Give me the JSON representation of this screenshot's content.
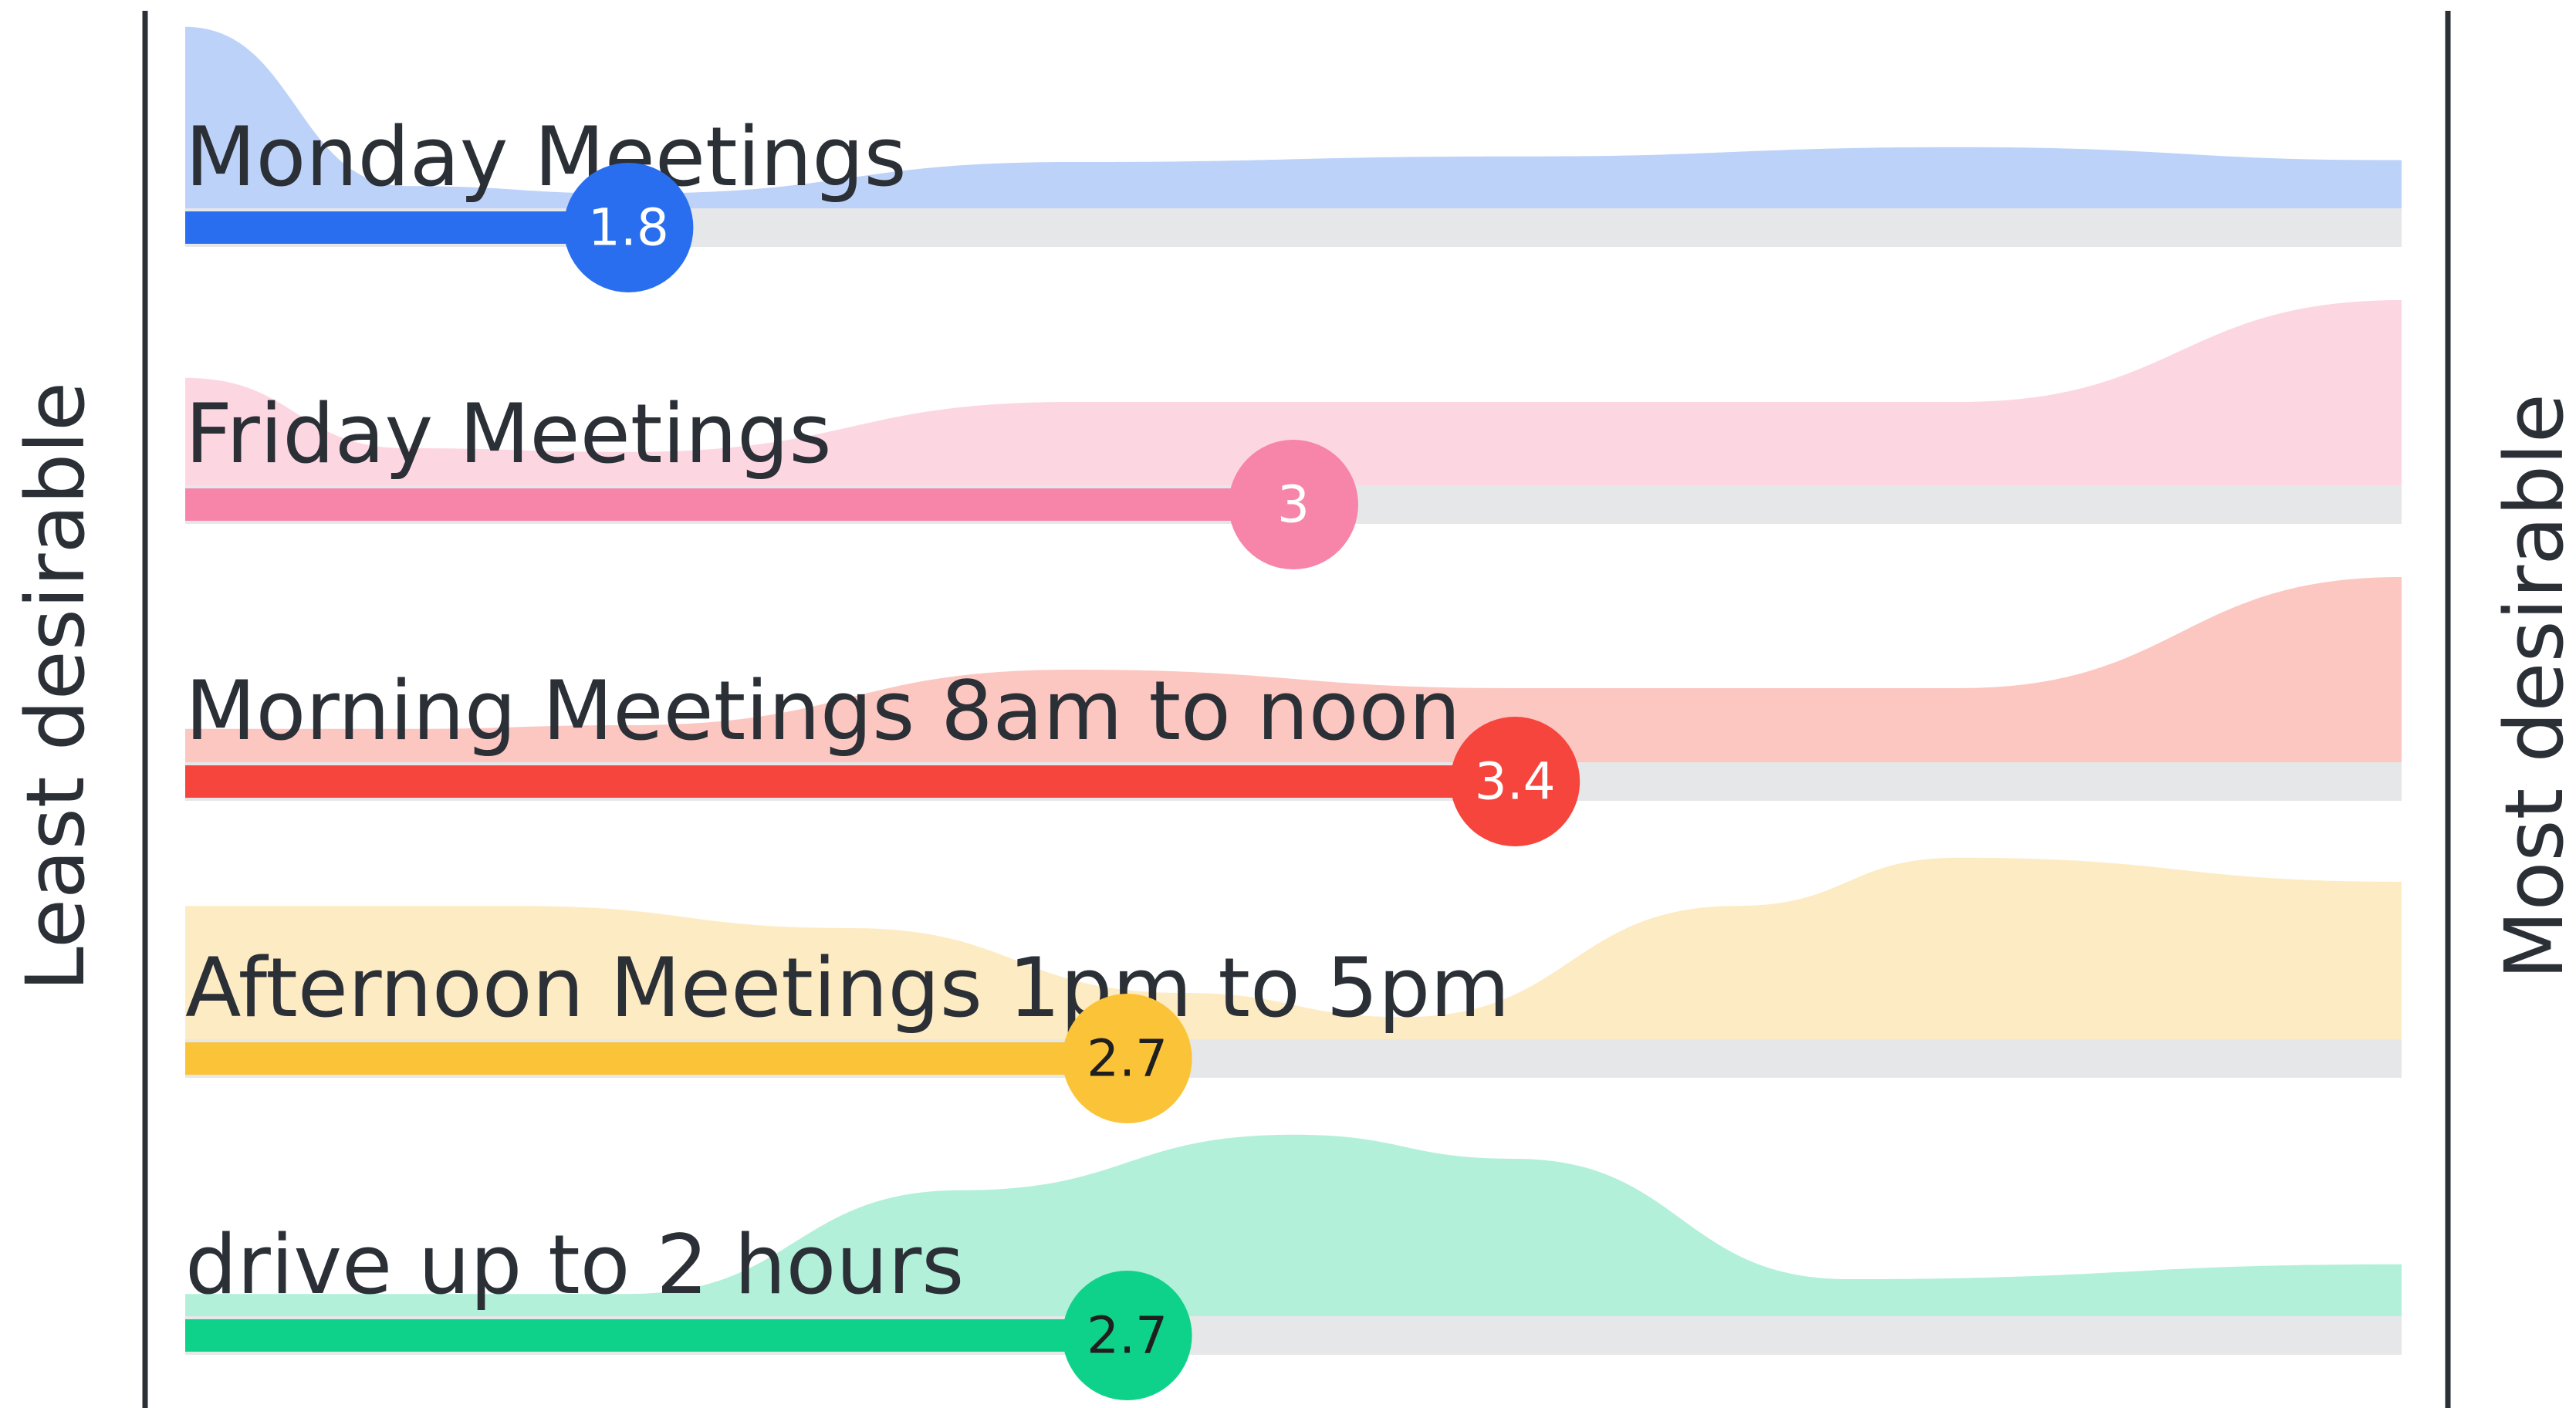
{
  "chart_data": {
    "type": "area",
    "left_label": "Least desirable",
    "right_label": "Most desirable",
    "scale_min": 1,
    "scale_max": 5,
    "rows": [
      {
        "label": "Monday Meetings",
        "score": 1.8,
        "score_text": "1.8",
        "color": "#2a6ef0",
        "area_color": "#bcd2f9",
        "text_color": "#ffffff",
        "distribution_x": [
          1.0,
          1.4,
          1.8,
          2.6,
          3.4,
          4.2,
          5.0
        ],
        "distribution_y": [
          0.98,
          0.12,
          0.08,
          0.25,
          0.28,
          0.33,
          0.26
        ]
      },
      {
        "label": "Friday Meetings",
        "score": 3,
        "score_text": "3",
        "color": "#f784a9",
        "area_color": "#fcd7e2",
        "text_color": "#ffffff",
        "distribution_x": [
          1.0,
          1.4,
          1.8,
          2.6,
          3.4,
          4.2,
          5.0
        ],
        "distribution_y": [
          0.58,
          0.2,
          0.18,
          0.45,
          0.45,
          0.45,
          1.0
        ]
      },
      {
        "label": "Morning Meetings 8am to noon",
        "score": 3.4,
        "score_text": "3.4",
        "color": "#f6453d",
        "area_color": "#fcc6c1",
        "text_color": "#ffffff",
        "distribution_x": [
          1.0,
          1.4,
          1.8,
          2.6,
          3.4,
          4.2,
          5.0
        ],
        "distribution_y": [
          0.18,
          0.18,
          0.2,
          0.5,
          0.4,
          0.4,
          1.0
        ]
      },
      {
        "label": "Afternoon Meetings 1pm to 5pm",
        "score": 2.7,
        "score_text": "2.7",
        "color": "#fbc338",
        "area_color": "#fdebc4",
        "text_color": "#1f1f1f",
        "distribution_x": [
          1.0,
          1.6,
          2.2,
          2.8,
          3.2,
          3.8,
          4.2,
          5.0
        ],
        "distribution_y": [
          0.72,
          0.72,
          0.6,
          0.25,
          0.12,
          0.72,
          0.98,
          0.85
        ]
      },
      {
        "label": "drive up to 2 hours",
        "score": 2.7,
        "score_text": "2.7",
        "color": "#0fd28a",
        "area_color": "#b2f0da",
        "text_color": "#1f1f1f",
        "distribution_x": [
          1.0,
          1.8,
          2.4,
          3.0,
          3.4,
          4.0,
          5.0
        ],
        "distribution_y": [
          0.12,
          0.12,
          0.68,
          0.98,
          0.85,
          0.2,
          0.28
        ]
      }
    ]
  }
}
